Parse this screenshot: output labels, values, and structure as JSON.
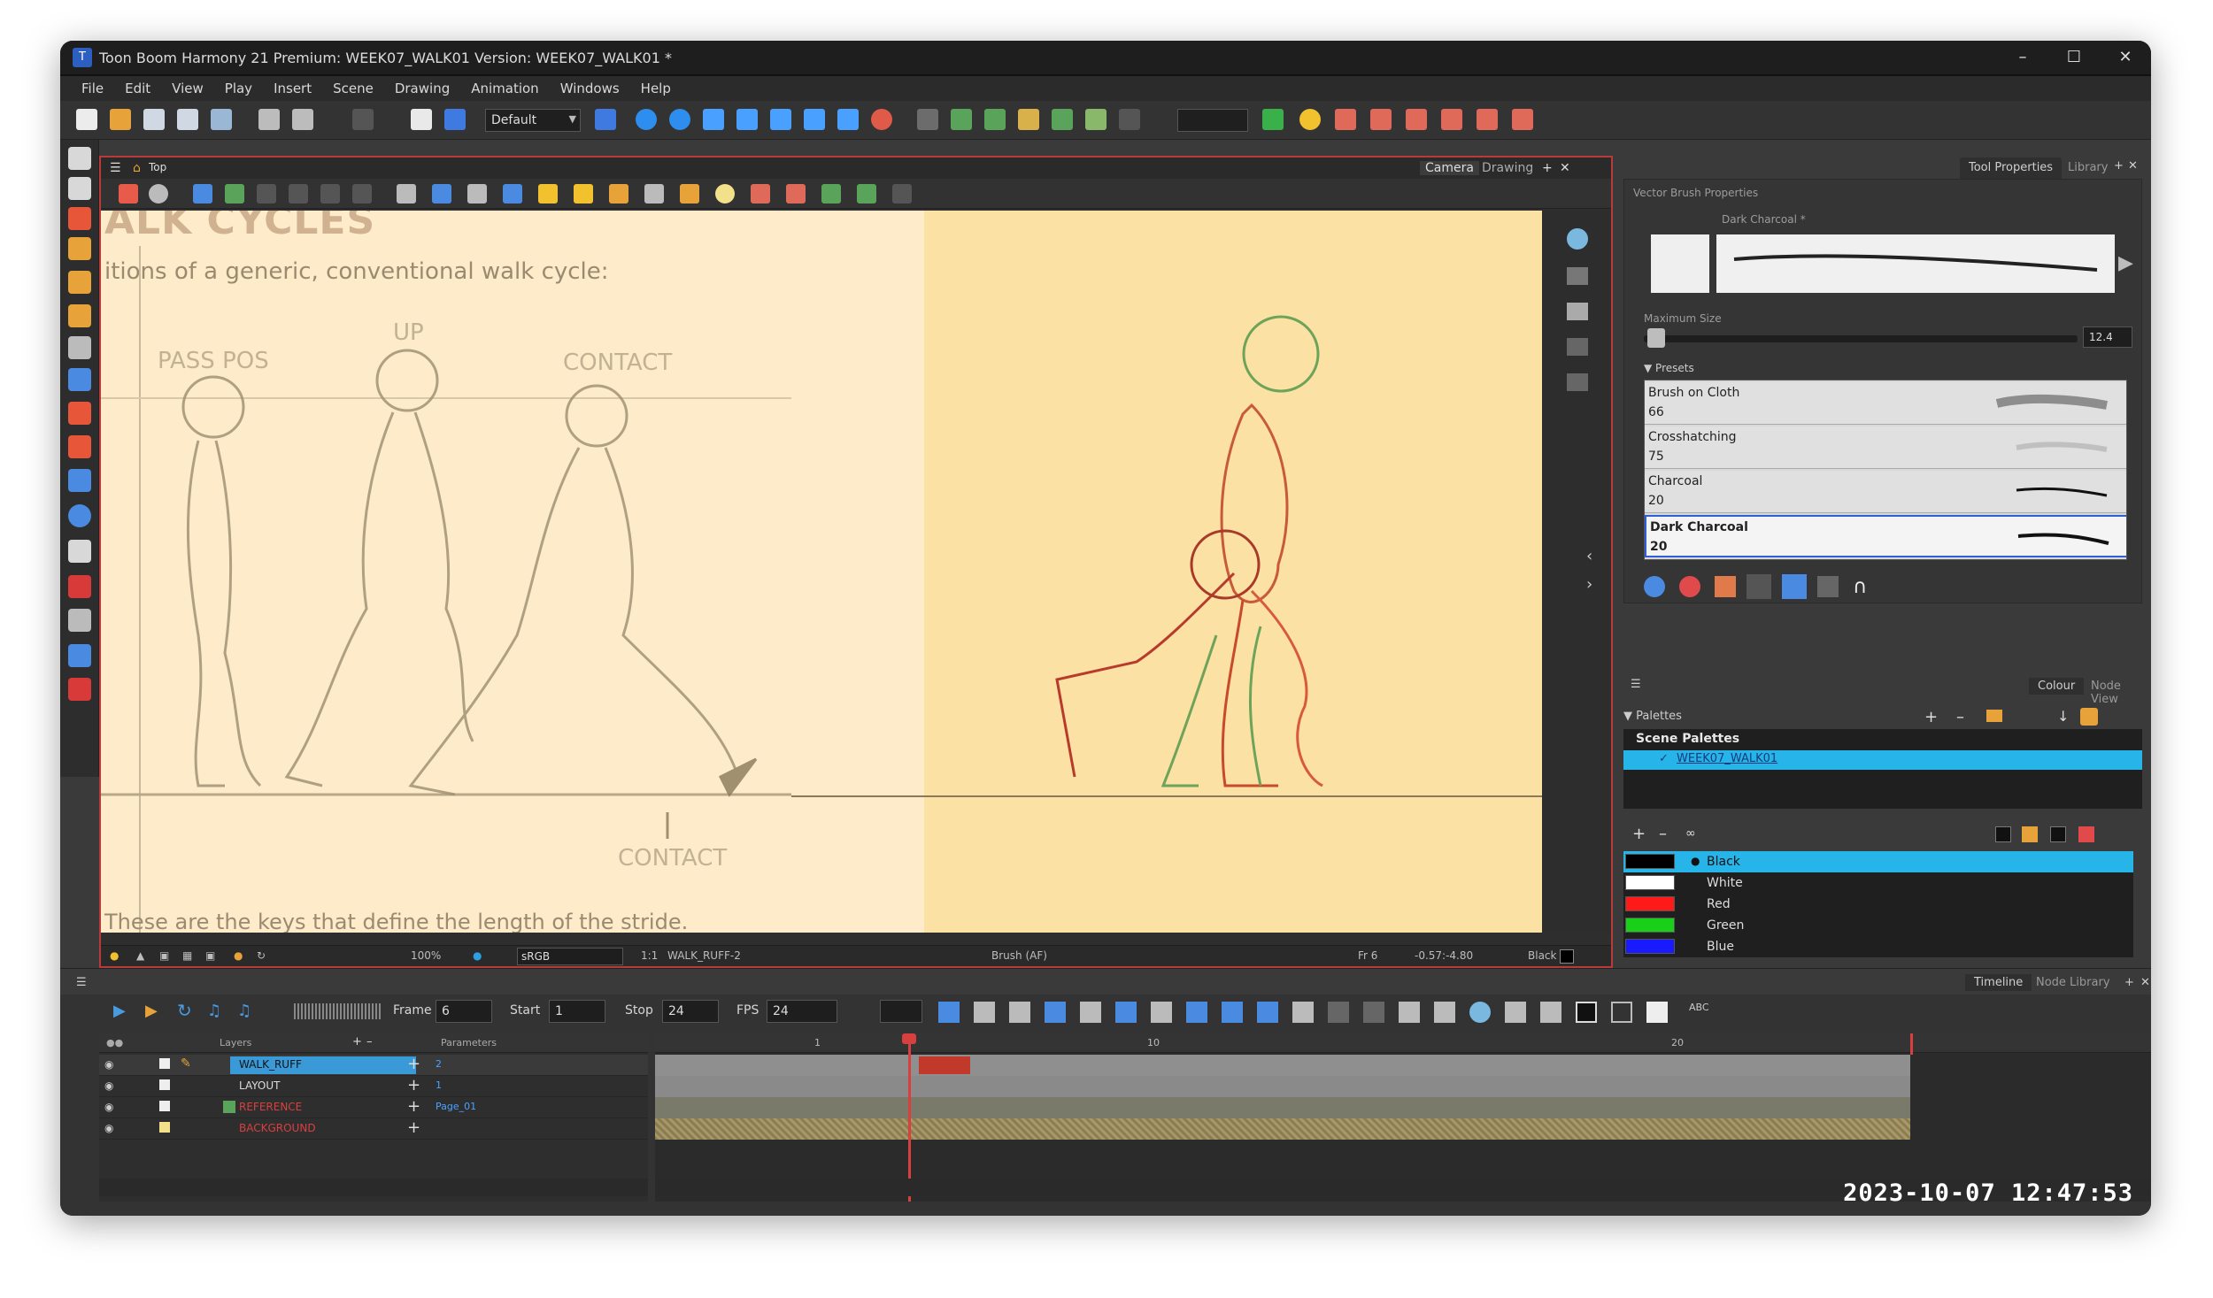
{
  "window": {
    "title": "Toon Boom Harmony 21 Premium: WEEK07_WALK01 Version: WEEK07_WALK01 *"
  },
  "menu": [
    "File",
    "Edit",
    "View",
    "Play",
    "Insert",
    "Scene",
    "Drawing",
    "Animation",
    "Windows",
    "Help"
  ],
  "toolbar": {
    "workspace": "Default"
  },
  "camera_view": {
    "breadcrumb": "Top",
    "tabs": [
      "Camera",
      "Drawing"
    ],
    "reference": {
      "title": "ALK CYCLES",
      "subtitle": "itions of a generic, conventional walk cycle:",
      "labels": [
        "PASS POS",
        "UP",
        "CONTACT",
        "CONTACT"
      ],
      "footer": "These are the keys that define the length of the stride."
    },
    "status": {
      "zoom": "100%",
      "colorspace": "sRGB",
      "ratio": "1:1",
      "drawing": "WALK_RUFF-2",
      "tool": "Brush (AF)",
      "frame": "Fr 6",
      "coords": "-0.57:-4.80",
      "colour": "Black"
    }
  },
  "tool_properties": {
    "tabs": [
      "Tool Properties",
      "Library"
    ],
    "section_title": "Vector Brush Properties",
    "brush_name": "Dark Charcoal *",
    "max_size_label": "Maximum Size",
    "max_size_value": "12.4",
    "presets_label": "Presets",
    "presets": [
      {
        "name": "Brush on Cloth",
        "size": "66"
      },
      {
        "name": "Crosshatching",
        "size": "75"
      },
      {
        "name": "Charcoal",
        "size": "20"
      },
      {
        "name": "Dark Charcoal",
        "size": "20"
      }
    ],
    "selected_preset": "Dark Charcoal"
  },
  "colour_panel": {
    "tabs": [
      "Colour",
      "Node View"
    ],
    "palettes_label": "Palettes",
    "scene_palettes_label": "Scene Palettes",
    "palette_name": "WEEK07_WALK01",
    "colours": [
      {
        "name": "Black",
        "hex": "#000000"
      },
      {
        "name": "White",
        "hex": "#ffffff"
      },
      {
        "name": "Red",
        "hex": "#ff1a1a"
      },
      {
        "name": "Green",
        "hex": "#19d019"
      },
      {
        "name": "Blue",
        "hex": "#1a1aff"
      }
    ],
    "selected": "Black"
  },
  "timeline": {
    "tabs": [
      "Timeline",
      "Node Library"
    ],
    "frame_label": "Frame",
    "frame_value": "6",
    "start_label": "Start",
    "start_value": "1",
    "stop_label": "Stop",
    "stop_value": "24",
    "fps_label": "FPS",
    "fps_value": "24",
    "columns": [
      "Layers",
      "Parameters"
    ],
    "layers": [
      {
        "name": "WALK_RUFF",
        "param": "2",
        "color": "#c8a24a"
      },
      {
        "name": "LAYOUT",
        "param": "1",
        "color": "#c8a24a"
      },
      {
        "name": "REFERENCE",
        "param": "Page_01",
        "color": "#d84040"
      },
      {
        "name": "BACKGROUND",
        "param": "",
        "color": "#d84040"
      }
    ],
    "ruler_numbers": [
      "1",
      "10",
      "20"
    ],
    "current_frame": 6,
    "scene_length": 24
  },
  "overlay": {
    "timestamp": "2023-10-07  12:47:53"
  }
}
